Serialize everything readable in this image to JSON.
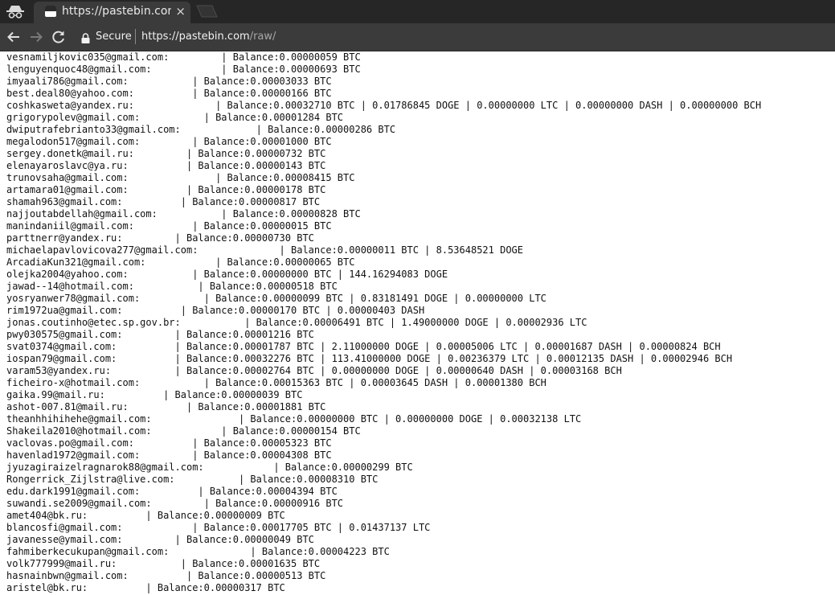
{
  "tab": {
    "title": "https://pastebin.com/raw/",
    "close": "×"
  },
  "toolbar": {
    "secure_label": "Secure",
    "url_host": "https://pastebin.com",
    "url_path": "/raw/"
  },
  "icons": {
    "incognito": "incognito-icon",
    "back": "back-arrow-icon",
    "forward": "forward-arrow-icon",
    "reload": "reload-icon",
    "lock": "lock-icon",
    "favicon": "pastebin-favicon-icon"
  },
  "lines": [
    "vesnamiljkovic035@gmail.com:         | Balance:0.00000059 BTC",
    "lenguyenquoc48@gmail.com:            | Balance:0.00000693 BTC",
    "imyaali786@gmail.com:           | Balance:0.00003033 BTC",
    "best.deal80@yahoo.com:          | Balance:0.00000166 BTC",
    "coshkasweta@yandex.ru:              | Balance:0.00032710 BTC | 0.01786845 DOGE | 0.00000000 LTC | 0.00000000 DASH | 0.00000000 BCH",
    "grigorypolev@gmail.com:           | Balance:0.00001284 BTC",
    "dwiputrafebrianto33@gmail.com:             | Balance:0.00000286 BTC",
    "megalodon517@gmail.com:         | Balance:0.00001000 BTC",
    "sergey.donetk@mail.ru:         | Balance:0.00000732 BTC",
    "elenayaroslavc@ya.ru:          | Balance:0.00000143 BTC",
    "trunovsaha@gmail.com:               | Balance:0.00008415 BTC",
    "artamara01@gmail.com:          | Balance:0.00000178 BTC",
    "shamah963@gmail.com:          | Balance:0.00000817 BTC",
    "najjoutabdellah@gmail.com:           | Balance:0.00000828 BTC",
    "manindaniil@gmail.com:          | Balance:0.00000015 BTC",
    "parttnerr@yandex.ru:         | Balance:0.00000730 BTC",
    "michaelapavlovicova277@gmail.com:              | Balance:0.00000011 BTC | 8.53648521 DOGE",
    "ArcadiaKun321@gmail.com:            | Balance:0.00000065 BTC",
    "olejka2004@yahoo.com:           | Balance:0.00000000 BTC | 144.16294083 DOGE",
    "jawad--14@hotmail.com:           | Balance:0.00000518 BTC",
    "yosryanwer78@gmail.com:           | Balance:0.00000099 BTC | 0.83181491 DOGE | 0.00000000 LTC",
    "rim1972ua@gmail.com:          | Balance:0.00000170 BTC | 0.00000403 DASH",
    "jonas.coutinho@etec.sp.gov.br:           | Balance:0.00006491 BTC | 1.49000000 DOGE | 0.00002936 LTC",
    "pwy030575@gmail.com:         | Balance:0.00001216 BTC",
    "svat0374@gmail.com:          | Balance:0.00001787 BTC | 2.11000000 DOGE | 0.00005006 LTC | 0.00001687 DASH | 0.00000824 BCH",
    "iospan79@gmail.com:          | Balance:0.00032276 BTC | 113.41000000 DOGE | 0.00236379 LTC | 0.00012135 DASH | 0.00002946 BCH",
    "varam53@yandex.ru:           | Balance:0.00002764 BTC | 0.00000000 DOGE | 0.00000640 DASH | 0.00003168 BCH",
    "ficheiro-x@hotmail.com:           | Balance:0.00015363 BTC | 0.00003645 DASH | 0.00001380 BCH",
    "gaika.99@mail.ru:          | Balance:0.00000039 BTC",
    "ashot-007.81@mail.ru:          | Balance:0.00001881 BTC",
    "theanhhihihehe@gmail.com:               | Balance:0.00000000 BTC | 0.00000000 DOGE | 0.00032138 LTC",
    "Shakeila2010@hotmail.com:            | Balance:0.00000154 BTC",
    "vaclovas.po@gmail.com:          | Balance:0.00005323 BTC",
    "havenlad1972@gmail.com:         | Balance:0.00004308 BTC",
    "jyuzagiraizelragnarok88@gmail.com:            | Balance:0.00000299 BTC",
    "Rongerrick_Zijlstra@live.com:           | Balance:0.00008310 BTC",
    "edu.dark1991@gmail.com:          | Balance:0.00004394 BTC",
    "suwandi.se2009@gmail.com:         | Balance:0.00000916 BTC",
    "amet404@bk.ru:          | Balance:0.00000009 BTC",
    "blancosfi@gmail.com:            | Balance:0.00017705 BTC | 0.01437137 LTC",
    "javanesse@ymail.com:         | Balance:0.00000049 BTC",
    "fahmiberkecukupan@gmail.com:              | Balance:0.00004223 BTC",
    "volk777999@mail.ru:           | Balance:0.00001635 BTC",
    "hasnainbwn@gmail.com:          | Balance:0.00000513 BTC",
    "aristel@bk.ru:          | Balance:0.00000317 BTC"
  ]
}
